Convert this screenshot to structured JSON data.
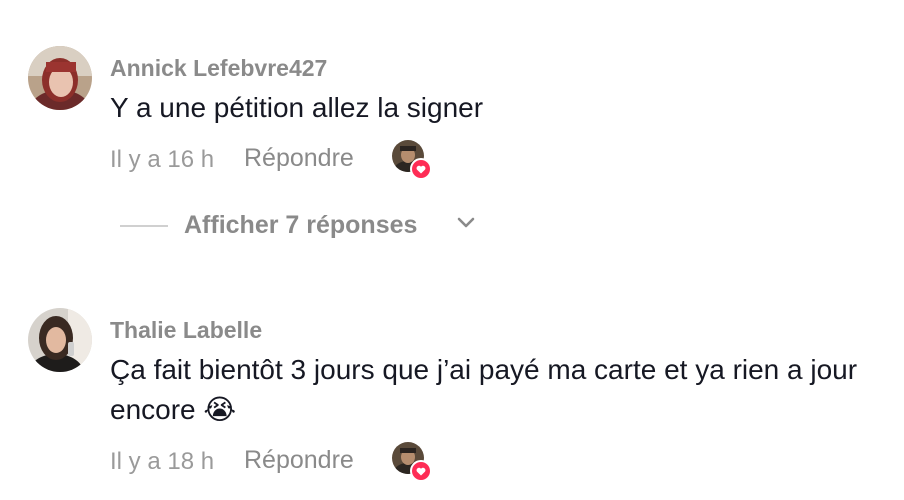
{
  "comments": [
    {
      "username": "Annick Lefebvre427",
      "text": "Y a une pétition allez la signer",
      "time": "Il y a 16 h",
      "reply_label": "Répondre",
      "avatar_icon": "user-avatar-redhair",
      "creator_liked": true
    },
    {
      "username": "Thalie Labelle",
      "text": "Ça fait bientôt 3 jours que j’ai payé ma carte et ya rien a jour encore 😭",
      "time": "Il y a 18 h",
      "reply_label": "Répondre",
      "avatar_icon": "user-avatar-selfie",
      "creator_liked": true
    }
  ],
  "view_replies": {
    "label": "Afficher 7 réponses",
    "icon": "chevron-down-icon"
  },
  "colors": {
    "text": "#161823",
    "secondary": "#8a8a8a",
    "heart": "#fe2c55"
  }
}
